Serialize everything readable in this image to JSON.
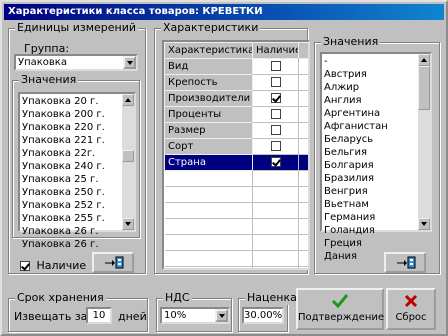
{
  "window": {
    "title": "Характеристики класса товаров: КРЕВЕТКИ"
  },
  "units": {
    "legend": "Единицы измерений",
    "group_label": "Группа:",
    "group_value": "Упаковка"
  },
  "values_left": {
    "legend": "Значения",
    "items": [
      "Упаковка 20 г.",
      "Упаковка 200 г.",
      "Упаковка 220 г.",
      "Упаковка 221 г.",
      "Упаковка 22г.",
      "Упаковка 240 г.",
      "Упаковка 25 г.",
      "Упаковка 250 г.",
      "Упаковка 252 г.",
      "Упаковка 255 г.",
      "Упаковка 26 г.",
      "Упаковка 26 г."
    ]
  },
  "presence": {
    "label": "Наличие",
    "checked": true
  },
  "characteristics": {
    "legend": "Характеристики",
    "col_name": "Характеристика",
    "col_presence": "Наличие",
    "rows": [
      {
        "name": "Вид",
        "checked": false
      },
      {
        "name": "Крепость",
        "checked": false
      },
      {
        "name": "Производители",
        "checked": true
      },
      {
        "name": "Проценты",
        "checked": false
      },
      {
        "name": "Размер",
        "checked": false
      },
      {
        "name": "Сорт",
        "checked": false
      },
      {
        "name": "Страна",
        "checked": true,
        "selected": true
      }
    ]
  },
  "values_right": {
    "legend": "Значения",
    "items": [
      "-",
      "Австрия",
      "Алжир",
      "Англия",
      "Аргентина",
      "Афганистан",
      "Беларусь",
      "Бельгия",
      "Болгария",
      "Бразилия",
      "Венгрия",
      "Вьетнам",
      "Германия",
      "Голандия",
      "Греция",
      "Дания"
    ]
  },
  "storage": {
    "legend": "Срок хранения",
    "notify_label": "Извещать за:",
    "days_value": "10",
    "days_label": "дней"
  },
  "vat": {
    "legend": "НДС",
    "value": "10%"
  },
  "markup": {
    "legend": "Наценка",
    "value": "30.00%"
  },
  "buttons": {
    "confirm": "Подтверждение",
    "reset": "Сброс"
  },
  "colors": {
    "selection": "#000080",
    "confirm_icon": "#1a9a1a",
    "reset_icon": "#c00000"
  }
}
